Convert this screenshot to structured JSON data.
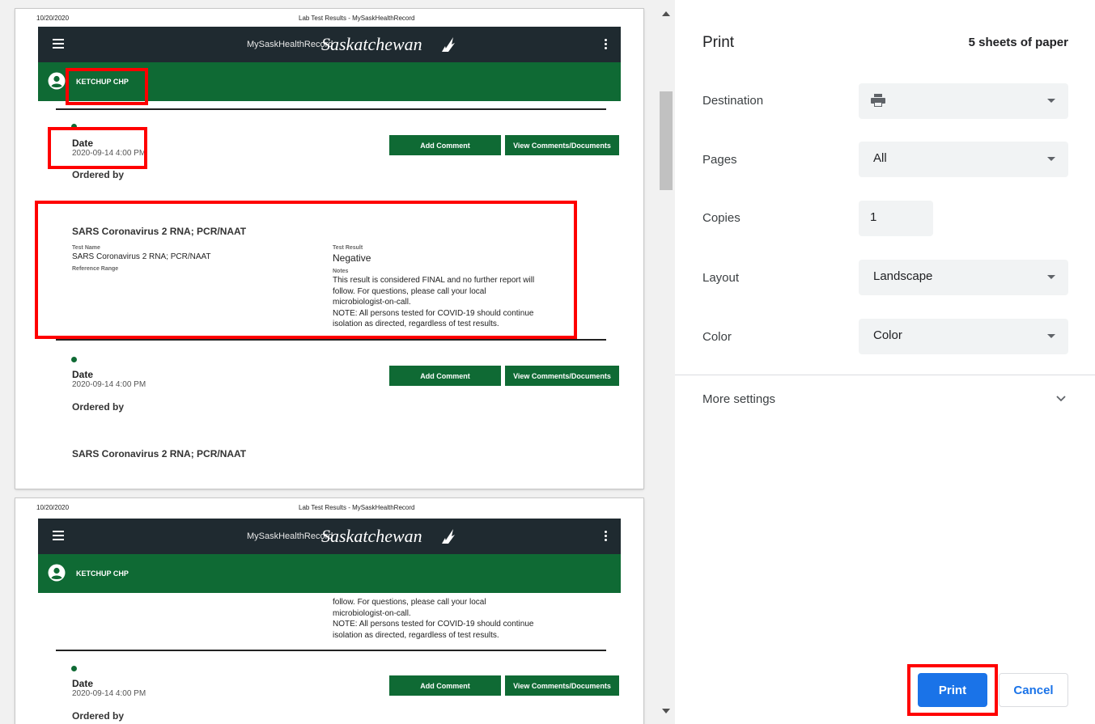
{
  "pages": [
    {
      "header_date": "10/20/2020",
      "header_title": "Lab Test Results - MySaskHealthRecord",
      "app": {
        "brand_small": "MySaskHealthRecord",
        "brand_big": "Saskatchewan",
        "user_name": "KETCHUP CHP"
      },
      "record1": {
        "date_label": "Date",
        "date_value": "2020-09-14 4:00 PM",
        "ordered_by": "Ordered by",
        "add_comment": "Add Comment",
        "view_comments": "View Comments/Documents",
        "test_title": "SARS Coronavirus 2 RNA; PCR/NAAT",
        "test_name_label": "Test Name",
        "test_name_value": "SARS Coronavirus 2 RNA; PCR/NAAT",
        "reference_range_label": "Reference Range",
        "test_result_label": "Test Result",
        "test_result_value": "Negative",
        "notes_label": "Notes",
        "notes_lines": [
          "This result is considered FINAL and no further report will",
          "follow. For questions, please call your local",
          "microbiologist-on-call.",
          "NOTE: All persons tested for COVID-19 should continue",
          "isolation as directed, regardless of test results."
        ]
      },
      "record2": {
        "date_label": "Date",
        "date_value": "2020-09-14 4:00 PM",
        "ordered_by": "Ordered by",
        "add_comment": "Add Comment",
        "view_comments": "View Comments/Documents",
        "test_title": "SARS Coronavirus 2 RNA; PCR/NAAT"
      }
    },
    {
      "header_date": "10/20/2020",
      "header_title": "Lab Test Results - MySaskHealthRecord",
      "app": {
        "brand_small": "MySaskHealthRecord",
        "brand_big": "Saskatchewan",
        "user_name": "KETCHUP CHP"
      },
      "notes_lines": [
        "follow. For questions, please call your local",
        "microbiologist-on-call.",
        "NOTE: All persons tested for COVID-19 should continue",
        "isolation as directed, regardless of test results."
      ],
      "record": {
        "date_label": "Date",
        "date_value": "2020-09-14 4:00 PM",
        "ordered_by": "Ordered by",
        "add_comment": "Add Comment",
        "view_comments": "View Comments/Documents"
      }
    }
  ],
  "print_panel": {
    "title": "Print",
    "sheets": "5 sheets of paper",
    "destination_label": "Destination",
    "destination_icon": "printer-icon",
    "pages_label": "Pages",
    "pages_value": "All",
    "copies_label": "Copies",
    "copies_value": "1",
    "layout_label": "Layout",
    "layout_value": "Landscape",
    "color_label": "Color",
    "color_value": "Color",
    "more_settings": "More settings",
    "print_button": "Print",
    "cancel_button": "Cancel"
  },
  "colors": {
    "app_bar": "#1f2a30",
    "user_bar": "#0f6a34",
    "highlight": "#ff0000",
    "primary": "#1a73e8"
  }
}
